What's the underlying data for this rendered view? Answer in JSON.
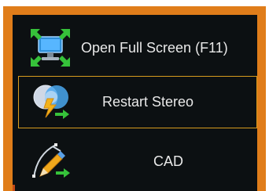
{
  "menu": {
    "items": [
      {
        "label": "Open Full Screen (F11)",
        "icon": "fullscreen-monitor-icon",
        "selected": false
      },
      {
        "label": "Restart Stereo",
        "icon": "stereo-restart-icon",
        "selected": true
      },
      {
        "label": "CAD",
        "icon": "cad-pencil-icon",
        "selected": false
      }
    ],
    "colors": {
      "frame": "#e07d1a",
      "panel": "#0c1012",
      "selection_border": "#d89b1e",
      "text": "#e9e9e9"
    }
  }
}
